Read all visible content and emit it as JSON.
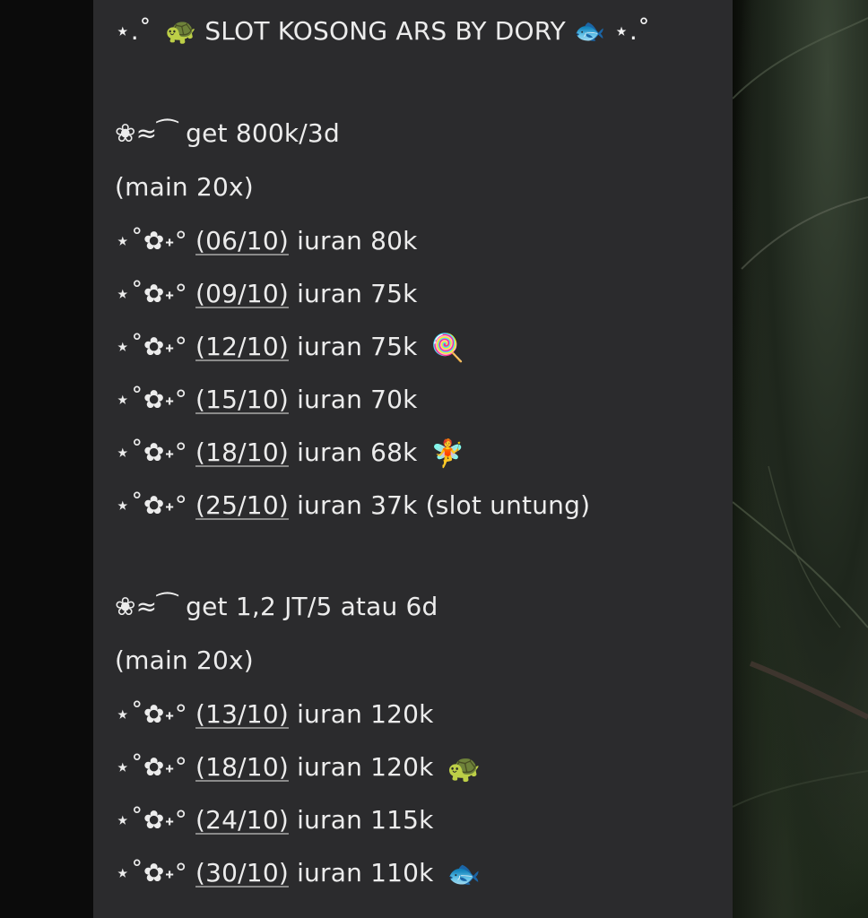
{
  "header": {
    "left_sparkle": "⋆.˚",
    "left_emoji": "🐢",
    "title": "SLOT KOSONG ARS BY DORY",
    "right_emoji": "🐟",
    "right_sparkle": "⋆.˚"
  },
  "sections": [
    {
      "bullet": "❀",
      "wave": "≈⁀",
      "heading": "get 800k/3d",
      "note": "(main 20x)",
      "rows": [
        {
          "prefix": "⋆˚✿˖°",
          "date": "(06/10)",
          "text": "iuran 80k",
          "emoji": ""
        },
        {
          "prefix": "⋆˚✿˖°",
          "date": "(09/10)",
          "text": "iuran 75k",
          "emoji": ""
        },
        {
          "prefix": "⋆˚✿˖°",
          "date": "(12/10)",
          "text": "iuran 75k",
          "emoji": "🍭"
        },
        {
          "prefix": "⋆˚✿˖°",
          "date": "(15/10)",
          "text": "iuran 70k",
          "emoji": ""
        },
        {
          "prefix": "⋆˚✿˖°",
          "date": "(18/10)",
          "text": "iuran 68k",
          "emoji": "🧚"
        },
        {
          "prefix": "⋆˚✿˖°",
          "date": "(25/10)",
          "text": "iuran 37k (slot untung)",
          "emoji": ""
        }
      ]
    },
    {
      "bullet": "❀",
      "wave": "≈⁀",
      "heading": "get 1,2 JT/5 atau 6d",
      "note": "(main 20x)",
      "rows": [
        {
          "prefix": "⋆˚✿˖°",
          "date": "(13/10)",
          "text": "iuran 120k",
          "emoji": ""
        },
        {
          "prefix": "⋆˚✿˖°",
          "date": "(18/10)",
          "text": "iuran 120k",
          "emoji": "🐢"
        },
        {
          "prefix": "⋆˚✿˖°",
          "date": "(24/10)",
          "text": "iuran 115k",
          "emoji": ""
        },
        {
          "prefix": "⋆˚✿˖°",
          "date": "(30/10)",
          "text": "iuran 110k",
          "emoji": "🐟"
        }
      ]
    }
  ]
}
